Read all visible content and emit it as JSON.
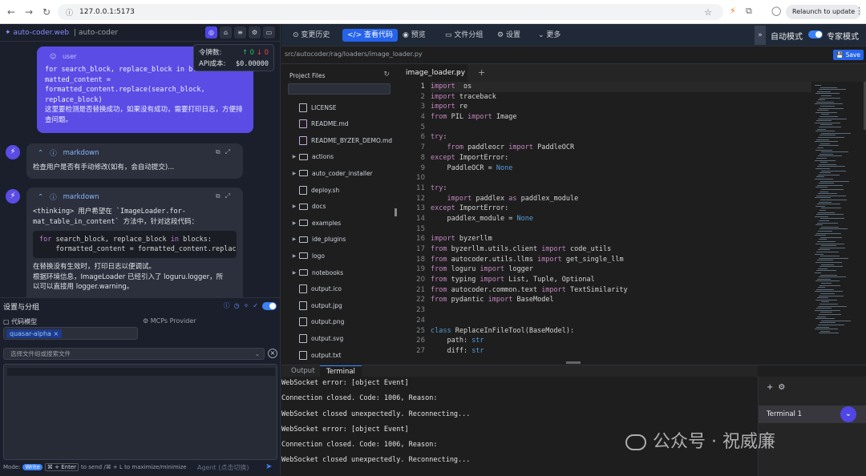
{
  "browser": {
    "url": "127.0.0.1:5173",
    "relaunch_label": "Relaunch to update"
  },
  "left_header": {
    "brand": "auto-coder.web",
    "project": "| auto-coder"
  },
  "token_box": {
    "tokens_label": "令牌数:",
    "tokens_up": "↑ 0",
    "tokens_down": "↓ 0",
    "cost_label": "API成本:",
    "cost_value": "$0.00000"
  },
  "user_message": {
    "role": "user",
    "code": "for search_block, replace_block in bl\nmatted_content =\nformatted_content.replace(search_block,\nreplace_block)",
    "text": "这里要检测是否替换成功，如果没有成功，需要打印日志，方便排查问题。"
  },
  "bot_messages": [
    {
      "type": "markdown",
      "text": "检查用户是否有手动修改(如有，会自动提交)..."
    },
    {
      "type": "markdown",
      "text1": "<thinking> 用户希望在 `ImageLoader.for-",
      "text2": "mat_table_in_content` 方法中，针对这段代码：",
      "code_kw1": "for",
      "code_l1": " search_block, replace_block ",
      "code_kw2": "in",
      "code_l1b": " blocks:",
      "code_l2": "    formatted_content = formatted_content.replace(se",
      "text3": "在替换没有生效时，打印日志以便调试。",
      "text4": "根据环境信息，ImageLoader 已经引入了 loguru.logger，所",
      "text5": "以可以直接用 logger.warning。"
    }
  ],
  "settings": {
    "title": "设置与分组",
    "tab_model": "代码模型",
    "tab_mcp": "MCPs Provider",
    "model_chip": "quasar-alpha ×",
    "file_placeholder": "选择文件组或搜索文件",
    "mode_label": "Mode:",
    "mode_value": "Write",
    "shortcut_key": "⌘ + Enter",
    "shortcut_text": "to send /⌘ + L to maximize/minimize",
    "agent_label": "Agent (点击切换)"
  },
  "topnav": {
    "items": [
      "变更历史",
      "查看代码",
      "预览",
      "文件分组",
      "设置",
      "更多"
    ],
    "active_index": 1,
    "auto_mode": "自动模式",
    "expert_mode": "专家模式"
  },
  "pathbar": {
    "path": "src/autocoder/rag/loaders/image_loader.py",
    "save": "Save"
  },
  "file_tree": {
    "title": "Project Files",
    "items": [
      {
        "name": "LICENSE",
        "kind": "file"
      },
      {
        "name": "README.md",
        "kind": "md"
      },
      {
        "name": "README_BYZER_DEMO.md",
        "kind": "md"
      },
      {
        "name": "actions",
        "kind": "dir"
      },
      {
        "name": "auto_coder_installer",
        "kind": "dir"
      },
      {
        "name": "deploy.sh",
        "kind": "file"
      },
      {
        "name": "docs",
        "kind": "dir"
      },
      {
        "name": "examples",
        "kind": "dir"
      },
      {
        "name": "ide_plugins",
        "kind": "dir"
      },
      {
        "name": "logo",
        "kind": "dir"
      },
      {
        "name": "notebooks",
        "kind": "dir"
      },
      {
        "name": "output.ico",
        "kind": "file"
      },
      {
        "name": "output.jpg",
        "kind": "file"
      },
      {
        "name": "output.png",
        "kind": "file"
      },
      {
        "name": "output.svg",
        "kind": "file"
      },
      {
        "name": "output.txt",
        "kind": "file"
      }
    ]
  },
  "editor": {
    "tab": "image_loader.py",
    "lines": [
      [
        [
          "k2",
          "import"
        ],
        [
          "",
          "  os"
        ]
      ],
      [
        [
          "k2",
          "import"
        ],
        [
          "",
          " traceback"
        ]
      ],
      [
        [
          "k2",
          "import"
        ],
        [
          "",
          " re"
        ]
      ],
      [
        [
          "k2",
          "from"
        ],
        [
          "",
          " PIL "
        ],
        [
          "k2",
          "import"
        ],
        [
          "",
          " Image"
        ]
      ],
      [
        [
          "",
          ""
        ]
      ],
      [
        [
          "k2",
          "try"
        ],
        [
          "",
          ":"
        ]
      ],
      [
        [
          "",
          "    "
        ],
        [
          "k2",
          "from"
        ],
        [
          "",
          " paddleocr "
        ],
        [
          "k2",
          "import"
        ],
        [
          "",
          " PaddleOCR"
        ]
      ],
      [
        [
          "k2",
          "except"
        ],
        [
          "",
          " ImportError:"
        ]
      ],
      [
        [
          "",
          "    PaddleOCR = "
        ],
        [
          "k1",
          "None"
        ]
      ],
      [
        [
          "",
          ""
        ]
      ],
      [
        [
          "k2",
          "try"
        ],
        [
          "",
          ":"
        ]
      ],
      [
        [
          "",
          "    "
        ],
        [
          "k2",
          "import"
        ],
        [
          "",
          " paddlex "
        ],
        [
          "k2",
          "as"
        ],
        [
          "",
          " paddlex_module"
        ]
      ],
      [
        [
          "k2",
          "except"
        ],
        [
          "",
          " ImportError:"
        ]
      ],
      [
        [
          "",
          "    paddlex_module = "
        ],
        [
          "k1",
          "None"
        ]
      ],
      [
        [
          "",
          ""
        ]
      ],
      [
        [
          "k2",
          "import"
        ],
        [
          "",
          " byzerllm"
        ]
      ],
      [
        [
          "k2",
          "from"
        ],
        [
          "",
          " byzerllm.utils.client "
        ],
        [
          "k2",
          "import"
        ],
        [
          "",
          " code_utils"
        ]
      ],
      [
        [
          "k2",
          "from"
        ],
        [
          "",
          " autocoder.utils.llms "
        ],
        [
          "k2",
          "import"
        ],
        [
          "",
          " get_single_llm"
        ]
      ],
      [
        [
          "k2",
          "from"
        ],
        [
          "",
          " loguru "
        ],
        [
          "k2",
          "import"
        ],
        [
          "",
          " logger"
        ]
      ],
      [
        [
          "k2",
          "from"
        ],
        [
          "",
          " typing "
        ],
        [
          "k2",
          "import"
        ],
        [
          "",
          " List, Tuple, Optional"
        ]
      ],
      [
        [
          "k2",
          "from"
        ],
        [
          "",
          " autocoder.common.text "
        ],
        [
          "k2",
          "import"
        ],
        [
          "",
          " TextSimilarity"
        ]
      ],
      [
        [
          "k2",
          "from"
        ],
        [
          "",
          " pydantic "
        ],
        [
          "k2",
          "import"
        ],
        [
          "",
          " BaseModel"
        ]
      ],
      [
        [
          "",
          ""
        ]
      ],
      [
        [
          "",
          ""
        ]
      ],
      [
        [
          "k1",
          "class"
        ],
        [
          "",
          " ReplaceInFileTool(BaseModel):"
        ]
      ],
      [
        [
          "",
          "    path: "
        ],
        [
          "k1",
          "str"
        ]
      ],
      [
        [
          "",
          "    diff: "
        ],
        [
          "k1",
          "str"
        ]
      ]
    ]
  },
  "bottom": {
    "tabs": [
      "Output",
      "Terminal"
    ],
    "active_tab": 1,
    "terminal_lines": [
      "WebSocket error: [object Event]",
      "Connection closed. Code: 1006, Reason:",
      "WebSocket closed unexpectedly. Reconnecting...",
      "WebSocket error: [object Event]",
      "Connection closed. Code: 1006, Reason:",
      "WebSocket closed unexpectedly. Reconnecting..."
    ],
    "terminal_item": "Terminal 1"
  },
  "watermark": "公众号 · 祝威廉"
}
